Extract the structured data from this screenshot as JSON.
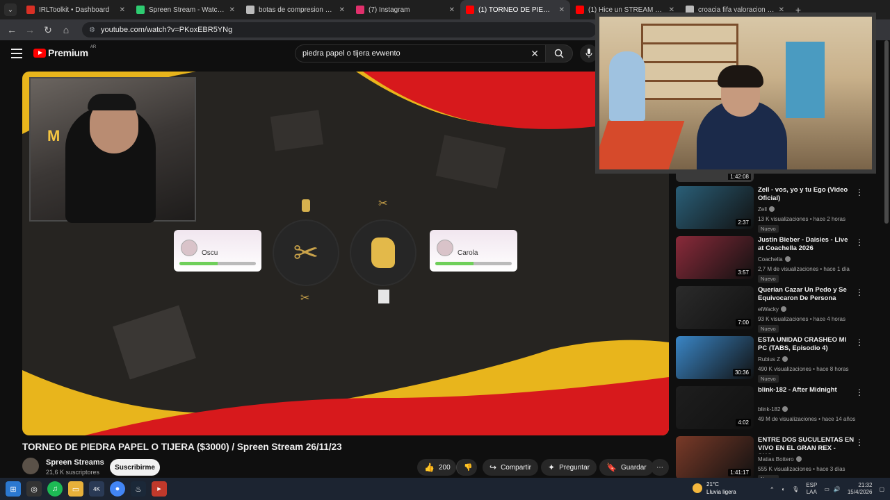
{
  "browser": {
    "tabs": [
      {
        "title": "IRLToolkit • Dashboard",
        "color": "#d93025",
        "active": false
      },
      {
        "title": "Spreen Stream - Watch Live on",
        "color": "#2ecc71",
        "active": false
      },
      {
        "title": "botas de compresion COMO F",
        "color": "#bbbbbb",
        "active": false
      },
      {
        "title": "(7) Instagram",
        "color": "#e1306c",
        "active": false
      },
      {
        "title": "(1) TORNEO DE PIEDRA PAPEL",
        "color": "#ff0000",
        "active": true
      },
      {
        "title": "(1) Hice un STREAM en los 90s",
        "color": "#ff0000",
        "active": false
      },
      {
        "title": "croacia fifa valoracion - Buscar",
        "color": "#bbbbbb",
        "active": false
      }
    ],
    "url": "youtube.com/watch?v=PKoxEBR5YNg"
  },
  "yt": {
    "logo": "Premium",
    "country": "AR",
    "search_query": "piedra papel o tijera evwento"
  },
  "player": {
    "players": [
      {
        "name": "Oscu",
        "progress": 0.5
      },
      {
        "name": "Carola",
        "progress": 0.5
      }
    ]
  },
  "video": {
    "title": "TORNEO DE PIEDRA PAPEL O TIJERA ($3000) / Spreen Stream 26/11/23",
    "channel": "Spreen Streams",
    "subscribers": "21,6 K suscriptores",
    "subscribe_label": "Suscribirme",
    "likes": "200",
    "share_label": "Compartir",
    "ask_label": "Preguntar",
    "save_label": "Guardar"
  },
  "recommendations": [
    {
      "title": "Zell - vos, yo y tu Ego (Video Oficial)",
      "channel": "Zell",
      "views": "13 K visualizaciones",
      "age": "hace 2 horas",
      "duration": "2:37",
      "badge": "Nuevo",
      "thumb": "#2a5f78"
    },
    {
      "title": "Justin Bieber - Daisies - Live at Coachella 2026",
      "channel": "Coachella",
      "views": "2,7 M de visualizaciones",
      "age": "hace 1 día",
      "duration": "3:57",
      "badge": "Nuevo",
      "thumb": "#8a2a3a"
    },
    {
      "title": "Querían Cazar Un Pedo y Se Equivocaron De Persona",
      "channel": "elWacky",
      "views": "93 K visualizaciones",
      "age": "hace 4 horas",
      "duration": "7:00",
      "badge": "Nuevo",
      "thumb": "#2b2b2b"
    },
    {
      "title": "ESTA UNIDAD CRASHEO MI PC (TABS, Episodio 4)",
      "channel": "Rubius Z",
      "views": "490 K visualizaciones",
      "age": "hace 8 horas",
      "duration": "30:36",
      "badge": "Nuevo",
      "thumb": "#3a86c6"
    },
    {
      "title": "blink-182 - After Midnight",
      "channel": "blink-182",
      "views": "49 M de visualizaciones",
      "age": "hace 14 años",
      "duration": "4:02",
      "badge": "",
      "thumb": "#1e1e1e"
    },
    {
      "title": "ENTRE DOS SUCULENTAS EN VIVO EN EL GRAN REX - SHO...",
      "channel": "Matias Bottero",
      "views": "555 K visualizaciones",
      "age": "hace 3 días",
      "duration": "1:41:17",
      "badge": "Nuevo",
      "thumb": "#7a3a28"
    }
  ],
  "partial_duration": "1:42:08",
  "taskbar": {
    "weather_temp": "21°C",
    "weather_desc": "Lluvia ligera",
    "lang": "ESP",
    "lang2": "LAA",
    "time": "21:32",
    "date": "15/4/2026"
  }
}
